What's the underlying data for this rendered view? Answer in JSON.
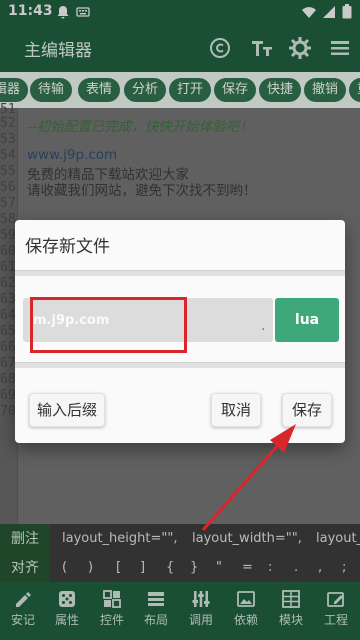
{
  "status": {
    "time": "11:43"
  },
  "appbar": {
    "title": "主编辑器"
  },
  "chips": [
    "辑器",
    "待输",
    "表情",
    "分析",
    "打开",
    "保存",
    "快捷",
    "撤销",
    "重"
  ],
  "editor": {
    "line_numbers": [
      "51",
      "52",
      "53",
      "54",
      "55",
      "56",
      "57",
      "58",
      "59",
      "60",
      "61",
      "62",
      "63",
      "64",
      "65",
      "66",
      "67",
      "68",
      "69",
      "70"
    ],
    "lines": {
      "comment": "--初始配置已完成，快快开始体验吧！",
      "url": "www.j9p.com",
      "line1": "免费的精品下载站欢迎大家",
      "line2": "请收藏我们网站，避免下次找不到哟！"
    }
  },
  "quick": {
    "row1_label": "删注",
    "row1_items": [
      "layout_height=\"\",",
      "layout_width=\"\",",
      "layout_"
    ],
    "row2_label": "对齐",
    "row2_items": [
      "(",
      ")",
      "[",
      "]",
      "{",
      "}",
      "\"",
      "=",
      ":",
      ".",
      ",",
      ";",
      "_"
    ]
  },
  "bottom_nav": [
    "安记",
    "属性",
    "控件",
    "布局",
    "调用",
    "依赖",
    "模块",
    "工程"
  ],
  "dialog": {
    "title": "保存新文件",
    "filename_value": "m.j9p.com",
    "dot": ".",
    "extension": "lua",
    "suffix_button": "输入后缀",
    "cancel_button": "取消",
    "save_button": "保存"
  },
  "colors": {
    "primary": "#1f5a3c",
    "accent": "#3ea87a",
    "annotation": "#d9262c"
  }
}
